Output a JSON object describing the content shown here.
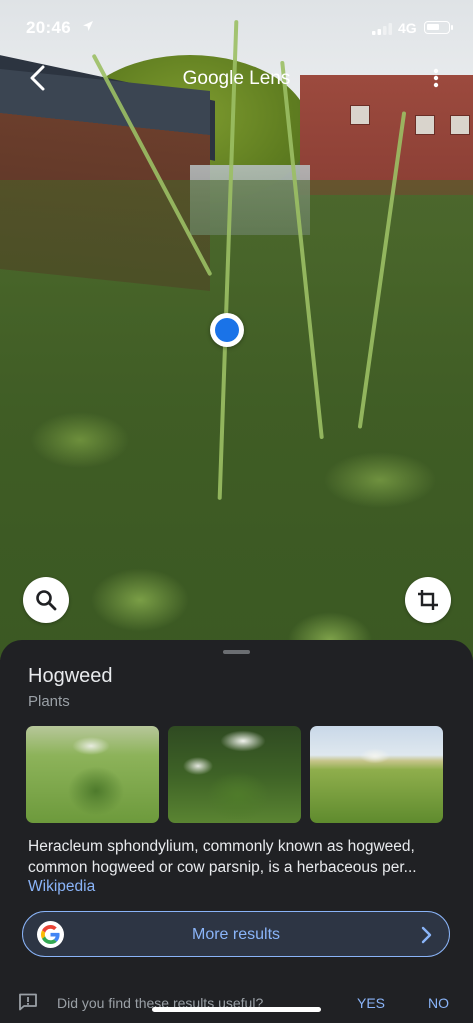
{
  "status_bar": {
    "time": "20:46",
    "network": "4G",
    "icons": [
      "location-arrow-icon",
      "signal-icon",
      "battery-icon"
    ]
  },
  "top_bar": {
    "title": "Google Lens",
    "icons": [
      "back-chevron-icon",
      "more-vert-icon"
    ]
  },
  "photo": {
    "controls": [
      "search-icon",
      "crop-icon"
    ]
  },
  "result": {
    "title": "Hogweed",
    "category": "Plants",
    "images": [
      "hogweed-image-1",
      "hogweed-image-2",
      "hogweed-image-3"
    ],
    "description": "Heracleum sphondylium, commonly known as hogweed, common hogweed or cow parsnip, is a herbaceous per...",
    "source": "Wikipedia",
    "more_results_label": "More results"
  },
  "feedback": {
    "question": "Did you find these results useful?",
    "yes_label": "YES",
    "no_label": "NO"
  },
  "colors": {
    "accent": "#8ab4f8",
    "sheet_bg": "#202124",
    "focus_dot": "#1a73e8"
  }
}
